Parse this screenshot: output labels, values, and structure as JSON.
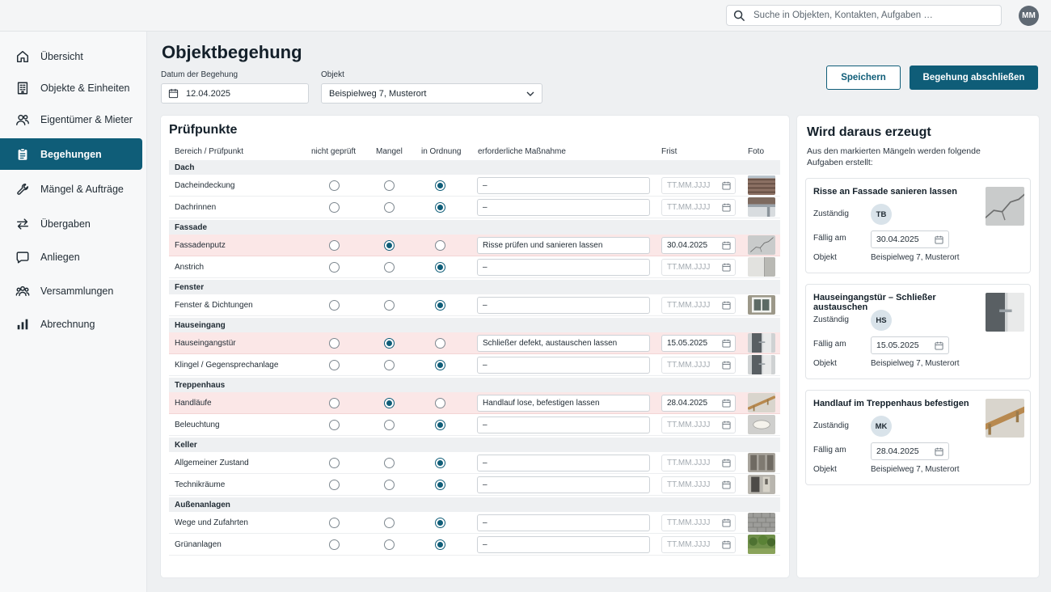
{
  "search": {
    "placeholder": "Suche in Objekten, Kontakten, Aufgaben …"
  },
  "user": {
    "initials": "MM"
  },
  "sidebar": {
    "items": [
      {
        "label": "Übersicht",
        "icon": "home-icon"
      },
      {
        "label": "Objekte & Einheiten",
        "icon": "building-icon"
      },
      {
        "label": "Eigentümer & Mieter",
        "icon": "users-icon"
      },
      {
        "label": "Begehungen",
        "icon": "clipboard-icon",
        "active": true
      },
      {
        "label": "Mängel & Aufträge",
        "icon": "wrench-icon"
      },
      {
        "label": "Übergaben",
        "icon": "swap-icon"
      },
      {
        "label": "Anliegen",
        "icon": "chat-icon"
      },
      {
        "label": "Versammlungen",
        "icon": "group-icon"
      },
      {
        "label": "Abrechnung",
        "icon": "bar-chart-icon"
      }
    ]
  },
  "header": {
    "title": "Objektbegehung",
    "date_label": "Datum der Begehung",
    "date_value": "12.04.2025",
    "object_label": "Objekt",
    "object_value": "Beispielweg 7, Musterort",
    "save_label": "Speichern",
    "finish_label": "Begehung abschließen"
  },
  "checklist": {
    "title": "Prüfpunkte",
    "columns": {
      "area": "Bereich / Prüfpunkt",
      "not_checked": "nicht geprüft",
      "defect": "Mangel",
      "ok": "in Ordnung",
      "measure": "erforderliche Maßnahme",
      "deadline": "Frist",
      "photo": "Foto"
    },
    "date_placeholder": "TT.MM.JJJJ",
    "sections": [
      {
        "name": "Dach",
        "items": [
          {
            "name": "Dacheindeckung",
            "status": "ok",
            "measure": "–",
            "deadline": "",
            "photo": "roof-tiles"
          },
          {
            "name": "Dachrinnen",
            "status": "ok",
            "measure": "–",
            "deadline": "",
            "photo": "gutter"
          }
        ]
      },
      {
        "name": "Fassade",
        "items": [
          {
            "name": "Fassadenputz",
            "status": "defect",
            "measure": "Risse prüfen und sanieren lassen",
            "deadline": "30.04.2025",
            "photo": "crack"
          },
          {
            "name": "Anstrich",
            "status": "ok",
            "measure": "–",
            "deadline": "",
            "photo": "wall"
          }
        ]
      },
      {
        "name": "Fenster",
        "items": [
          {
            "name": "Fenster & Dichtungen",
            "status": "ok",
            "measure": "–",
            "deadline": "",
            "photo": "window"
          }
        ]
      },
      {
        "name": "Hauseingang",
        "items": [
          {
            "name": "Hauseingangstür",
            "status": "defect",
            "measure": "Schließer defekt, austauschen lassen",
            "deadline": "15.05.2025",
            "photo": "door"
          },
          {
            "name": "Klingel / Gegensprechanlage",
            "status": "ok",
            "measure": "–",
            "deadline": "",
            "photo": "door"
          }
        ]
      },
      {
        "name": "Treppenhaus",
        "items": [
          {
            "name": "Handläufe",
            "status": "defect",
            "measure": "Handlauf lose, befestigen lassen",
            "deadline": "28.04.2025",
            "photo": "handrail"
          },
          {
            "name": "Beleuchtung",
            "status": "ok",
            "measure": "–",
            "deadline": "",
            "photo": "lamp"
          }
        ]
      },
      {
        "name": "Keller",
        "items": [
          {
            "name": "Allgemeiner Zustand",
            "status": "ok",
            "measure": "–",
            "deadline": "",
            "photo": "basement"
          },
          {
            "name": "Technikräume",
            "status": "ok",
            "measure": "–",
            "deadline": "",
            "photo": "tech-room"
          }
        ]
      },
      {
        "name": "Außenanlagen",
        "items": [
          {
            "name": "Wege und Zufahrten",
            "status": "ok",
            "measure": "–",
            "deadline": "",
            "photo": "paving"
          },
          {
            "name": "Grünanlagen",
            "status": "ok",
            "measure": "–",
            "deadline": "",
            "photo": "garden"
          }
        ]
      }
    ]
  },
  "generated": {
    "title": "Wird daraus erzeugt",
    "description": "Aus den markierten Mängeln werden folgende Aufgaben erstellt:",
    "assignee_label": "Zuständig",
    "due_label": "Fällig am",
    "object_label": "Objekt",
    "tasks": [
      {
        "title": "Risse an Fassade sanieren lassen",
        "assignee": "TB",
        "due": "30.04.2025",
        "object": "Beispielweg 7, Musterort",
        "photo": "crack"
      },
      {
        "title": "Hauseingangstür – Schließer austauschen",
        "assignee": "HS",
        "due": "15.05.2025",
        "object": "Beispielweg 7, Musterort",
        "photo": "door"
      },
      {
        "title": "Handlauf im Treppenhaus befestigen",
        "assignee": "MK",
        "due": "28.04.2025",
        "object": "Beispielweg 7, Musterort",
        "photo": "handrail"
      }
    ]
  },
  "colors": {
    "accent": "#0f5d78",
    "defect_row": "#fbe7e7"
  }
}
